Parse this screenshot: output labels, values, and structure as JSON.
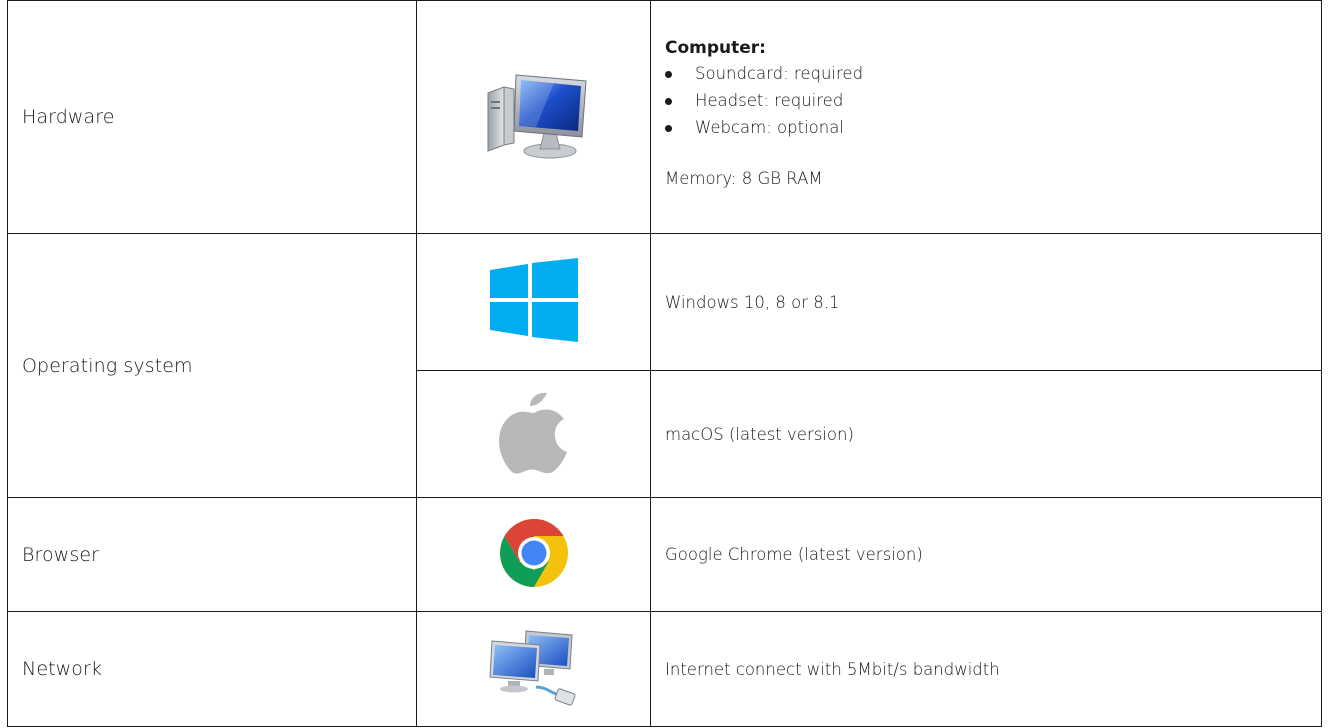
{
  "rows": {
    "hardware": {
      "label": "Hardware",
      "icon": "desktop-computer-icon",
      "title": "Computer:",
      "items": [
        "Soundcard: required",
        "Headset: required",
        "Webcam: optional"
      ],
      "memory": "Memory: 8 GB RAM"
    },
    "os": {
      "label": "Operating system",
      "windows": {
        "icon": "windows-logo-icon",
        "text": "Windows 10, 8 or 8.1"
      },
      "mac": {
        "icon": "apple-logo-icon",
        "text": "macOS (latest version)"
      }
    },
    "browser": {
      "label": "Browser",
      "icon": "chrome-logo-icon",
      "text": "Google Chrome (latest version)"
    },
    "network": {
      "label": "Network",
      "icon": "network-computers-icon",
      "text": "Internet connect with 5Mbit/s bandwidth"
    }
  },
  "colors": {
    "windows_blue": "#00adef",
    "chrome_red": "#db4437",
    "chrome_yellow": "#f4c20d",
    "chrome_green": "#0f9d58",
    "chrome_blue": "#4285f4",
    "apple_gray": "#b8b8b8"
  }
}
